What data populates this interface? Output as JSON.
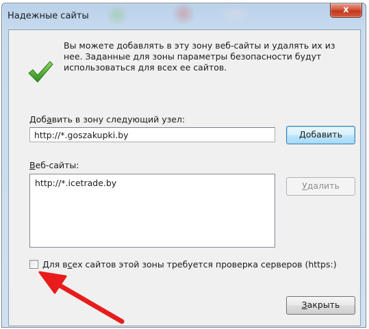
{
  "window": {
    "title": "Надежные сайты",
    "close_glyph": "x"
  },
  "intro": {
    "text": "Вы можете добавлять в эту зону  веб-сайты и удалять их из нее. Заданные для зоны параметры безопасности будут использоваться для всех ее сайтов."
  },
  "add_zone": {
    "label_pre": "Доб",
    "label_accel": "а",
    "label_post": "вить в зону следующий узел:",
    "input_value": "http://*.goszakupki.by",
    "add_button": {
      "accel": "Д",
      "rest": "обавить"
    }
  },
  "websites": {
    "label_accel": "В",
    "label_rest": "еб-сайты:",
    "items": [
      "http://*.icetrade.by"
    ],
    "remove_button": {
      "accel": "У",
      "rest": "далить"
    }
  },
  "https_checkbox": {
    "checked": false,
    "label_pre": "Для в",
    "label_accel": "с",
    "label_post": "ех сайтов этой зоны требуется проверка серверов (https:)"
  },
  "close_button": {
    "accel": "З",
    "rest": "акрыть"
  },
  "icons": {
    "check": "green-checkmark-icon",
    "annotation": "red-arrow"
  },
  "colors": {
    "check_green": "#4aa32a",
    "annotation_red": "#e81c1c",
    "titlebar": "#c7dbef",
    "close_red": "#c9462c"
  }
}
